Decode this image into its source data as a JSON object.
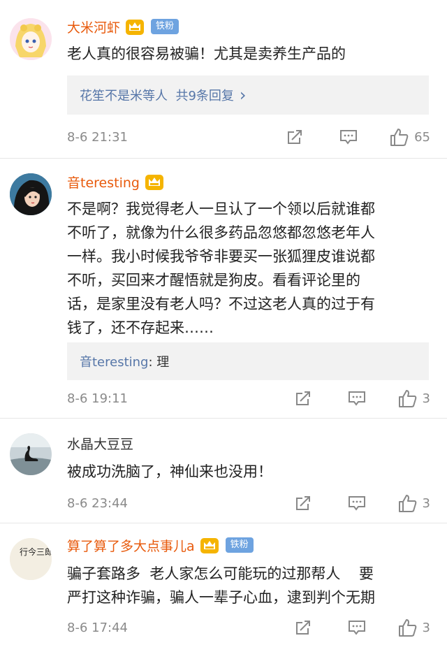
{
  "comments": [
    {
      "user": "大米河虾",
      "badge": "铁粉",
      "content_lines": [
        "老人真的很容易被骗！尤其是卖养生产品的"
      ],
      "reply": {
        "prefix": "花笙不是米",
        "mid": "等人  共9条回复",
        "arrow": "›"
      },
      "time": "8-6 21:31",
      "likes": "65"
    },
    {
      "user": "音teresting",
      "badge": "",
      "content_lines": [
        "不是啊？我觉得老人一旦认了一个领以后就谁都",
        "不听了，就像为什么很多药品忽悠都忽悠老年人",
        "一样。我小时候我爷爷非要买一张狐狸皮谁说都",
        "不听，买回来才醒悟就是狗皮。看看评论里的",
        "话，是家里没有老人吗？不过这老人真的过于有",
        "钱了，还不存起来……"
      ],
      "reply": {
        "prefix": "音teresting",
        "mid": ": 理",
        "arrow": ""
      },
      "time": "8-6 19:11",
      "likes": "3"
    },
    {
      "user": "水晶大豆豆",
      "badge": "",
      "content_lines": [
        "被成功洗脑了，神仙来也没用！"
      ],
      "time": "8-6 23:44",
      "likes": "3"
    },
    {
      "user": "算了算了多大点事儿a",
      "badge": "铁粉",
      "avatar_text": "行今三郎",
      "content_lines": [
        "骗子套路多  老人家怎么可能玩的过那帮人    要",
        "严打这种诈骗，骗人一辈子心血，逮到判个无期"
      ],
      "time": "8-6 17:44",
      "likes": "3"
    }
  ],
  "icons": {
    "share": "share-icon",
    "comment": "comment-icon",
    "like": "thumbs-up-icon",
    "crown": "crown-icon",
    "reply_arrow": "chevron-right-icon"
  },
  "colors": {
    "vip_name": "#e85a0c",
    "reply_link": "#5676a8",
    "badge_bg": "#6ea3e0",
    "crown": "#f0a000"
  }
}
